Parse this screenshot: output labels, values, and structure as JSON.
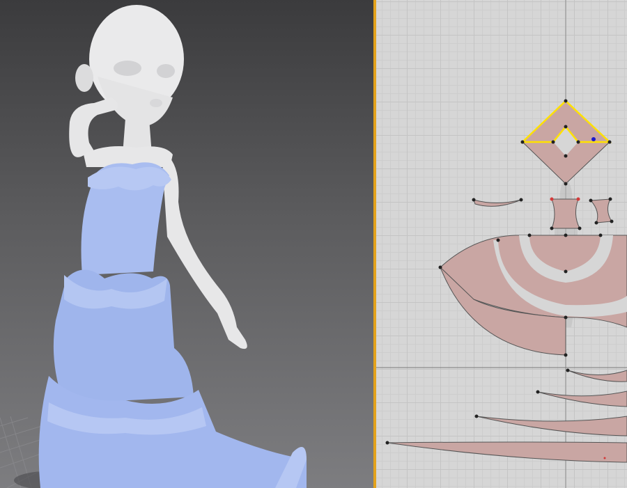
{
  "colors": {
    "divider": "#e3a21c",
    "fabric": "#a9bdf0",
    "skin": "#e9e9ea",
    "pattern_piece": "#c9a6a3",
    "selection": "#ffe100",
    "selected_point": "#1a1acc",
    "point": "#222222",
    "red_point": "#d33a3a"
  },
  "viewport3d": {
    "icon": "avatar-with-dress"
  },
  "pattern_view": {
    "icon": "pattern-pieces"
  }
}
